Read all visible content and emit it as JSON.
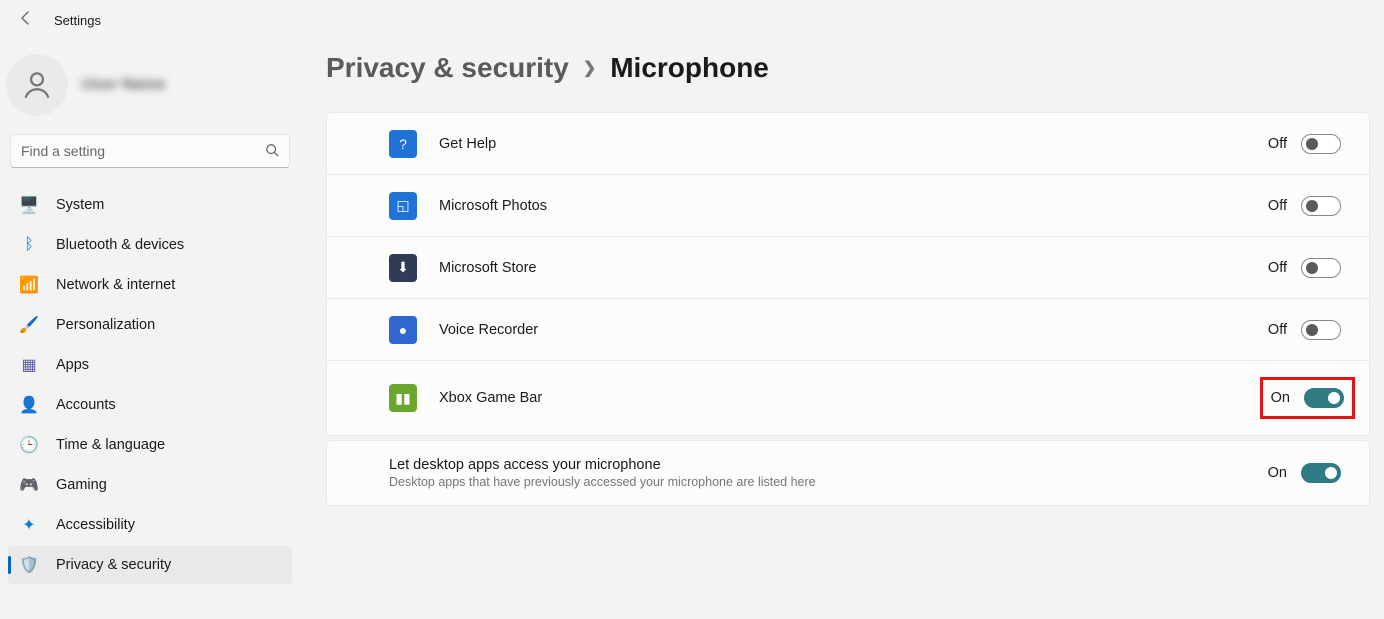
{
  "window": {
    "title": "Settings"
  },
  "user": {
    "name": "User Name"
  },
  "search": {
    "placeholder": "Find a setting"
  },
  "nav": {
    "items": [
      {
        "label": "System",
        "icon": "🖥️",
        "color": "#0078d4"
      },
      {
        "label": "Bluetooth & devices",
        "icon": "ᛒ",
        "color": "#0078d4"
      },
      {
        "label": "Network & internet",
        "icon": "📶",
        "color": "#0aa0e0"
      },
      {
        "label": "Personalization",
        "icon": "🖌️",
        "color": "#d47b2c"
      },
      {
        "label": "Apps",
        "icon": "▦",
        "color": "#5b5b9a"
      },
      {
        "label": "Accounts",
        "icon": "👤",
        "color": "#2aa777"
      },
      {
        "label": "Time & language",
        "icon": "🕒",
        "color": "#4b9bd6"
      },
      {
        "label": "Gaming",
        "icon": "🎮",
        "color": "#888"
      },
      {
        "label": "Accessibility",
        "icon": "✦",
        "color": "#0a7dcf"
      },
      {
        "label": "Privacy & security",
        "icon": "🛡️",
        "color": "#6d6d6d"
      }
    ],
    "selected_index": 9
  },
  "breadcrumb": {
    "parent": "Privacy & security",
    "current": "Microphone"
  },
  "apps": [
    {
      "name": "Get Help",
      "state": "Off",
      "on": false,
      "icon_bg": "#1f73d6",
      "icon_glyph": "?"
    },
    {
      "name": "Microsoft Photos",
      "state": "Off",
      "on": false,
      "icon_bg": "#1f73d6",
      "icon_glyph": "◱"
    },
    {
      "name": "Microsoft Store",
      "state": "Off",
      "on": false,
      "icon_bg": "#2f3b57",
      "icon_glyph": "⬇"
    },
    {
      "name": "Voice Recorder",
      "state": "Off",
      "on": false,
      "icon_bg": "#2f66cf",
      "icon_glyph": "●"
    },
    {
      "name": "Xbox Game Bar",
      "state": "On",
      "on": true,
      "icon_bg": "#6aa82d",
      "icon_glyph": "▮▮",
      "highlighted": true
    }
  ],
  "desktop": {
    "title": "Let desktop apps access your microphone",
    "subtitle": "Desktop apps that have previously accessed your microphone are listed here",
    "state": "On",
    "on": true
  },
  "colors": {
    "accent": "#2f7b84",
    "highlight": "#e31313"
  }
}
